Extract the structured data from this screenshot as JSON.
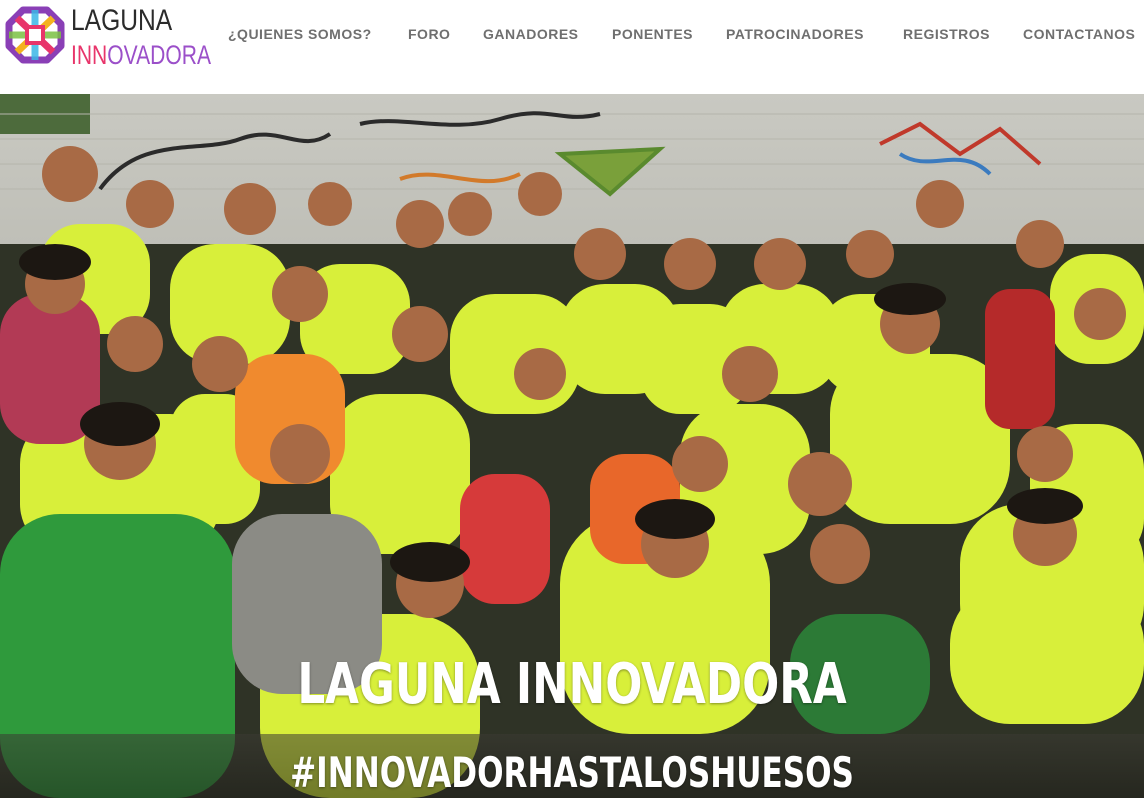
{
  "brand": {
    "line1": "LAGUNA",
    "line2_highlight": "INN",
    "line2_rest": "OVADORA",
    "colors": {
      "text_dark": "#2b2b2b",
      "inn": "#e8356b",
      "ovadora": "#9b4fc9"
    }
  },
  "nav": {
    "items": [
      {
        "label": "¿QUIENES SOMOS?"
      },
      {
        "label": "FORO"
      },
      {
        "label": "GANADORES"
      },
      {
        "label": "PONENTES"
      },
      {
        "label": "PATROCINADORES"
      },
      {
        "label": "REGISTROS"
      },
      {
        "label": "CONTACTANOS"
      }
    ],
    "color": "#6f6f6f"
  },
  "hero": {
    "title": "LAGUNA INNOVADORA",
    "hashtag": "#INNOVADORHASTALOSHUESOS",
    "shirt_text": "INNOVADOR HASTA LOS HUESOS",
    "shirt_color": "#d9f03a"
  }
}
